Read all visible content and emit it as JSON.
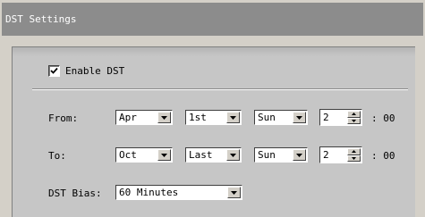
{
  "window": {
    "title": "DST Settings"
  },
  "enable": {
    "label": "Enable DST",
    "checked": true
  },
  "from": {
    "label": "From:",
    "month": "Apr",
    "week": "1st",
    "day": "Sun",
    "hour": "2",
    "minutes_suffix": ": 00"
  },
  "to": {
    "label": "To:",
    "month": "Oct",
    "week": "Last",
    "day": "Sun",
    "hour": "2",
    "minutes_suffix": ": 00"
  },
  "bias": {
    "label": "DST Bias:",
    "value": "60 Minutes"
  }
}
